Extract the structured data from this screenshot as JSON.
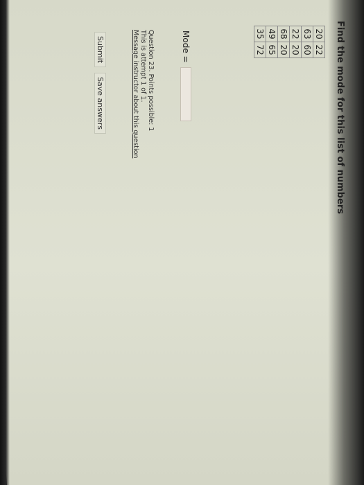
{
  "question": {
    "title": "Find the mode for this list of numbers",
    "table": [
      [
        "20",
        "22"
      ],
      [
        "63",
        "60"
      ],
      [
        "22",
        "20"
      ],
      [
        "68",
        "20"
      ],
      [
        "49",
        "65"
      ],
      [
        "35",
        "72"
      ]
    ],
    "mode_label": "Mode =",
    "mode_value": ""
  },
  "info": {
    "points": "Question 23. Points possible: 1",
    "attempt": "This is attempt 1 of 1.",
    "message_link": "Message instructor about this question"
  },
  "buttons": {
    "submit": "Submit",
    "save": "Save answers"
  },
  "colors": {
    "page_background": "#dcdecf",
    "input_background": "#ece7df",
    "table_border": "#8a8a8a"
  }
}
